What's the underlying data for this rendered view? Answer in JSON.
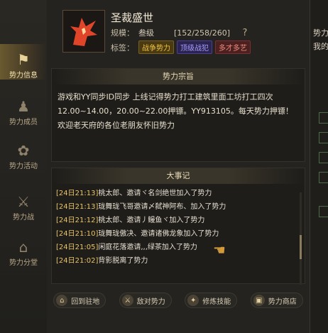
{
  "nav": {
    "items": [
      {
        "label": "势力信息",
        "icon": "banner-icon",
        "active": true
      },
      {
        "label": "势力成员",
        "icon": "people-icon",
        "active": false
      },
      {
        "label": "势力活动",
        "icon": "activity-icon",
        "active": false
      },
      {
        "label": "势力战",
        "icon": "battle-icon",
        "active": false
      },
      {
        "label": "势力分堂",
        "icon": "pavilion-icon",
        "active": false
      }
    ]
  },
  "guild": {
    "name": "圣裁盛世",
    "scale_label": "规模：",
    "scale_value": "叁级",
    "members": "[152/258/260]",
    "help": "?",
    "tags_label": "标签：",
    "tags": [
      "战争势力",
      "顶级战犯",
      "多才多艺"
    ]
  },
  "declaration": {
    "title": "势力宗旨",
    "text": "游戏和YY同步ID同步 上线记得势力打工建筑里面工坊打工四次12.00~14.00，20.00~22.00押镖。YY913105。每天势力押镖！欢迎老天府的各位老朋友怀旧势力"
  },
  "events": {
    "title": "大事记",
    "items": [
      {
        "time": "[24日21:13]",
        "text": "桃太郎、邀请ヾ名剑绝世加入了势力"
      },
      {
        "time": "[24日21:13]",
        "text": "珑舞珑飞哥邀请〆弑神阿布、加入了势力"
      },
      {
        "time": "[24日21:12]",
        "text": "桃太郎、邀请丿鳗鱼ヾ加入了势力"
      },
      {
        "time": "[24日21:10]",
        "text": "珑舞珑傲决、邀请诸佛龙象加入了势力"
      },
      {
        "time": "[24日21:05]",
        "text": "闲庭花落邀请,,,绿茶加入了势力"
      },
      {
        "time": "[24日21:02]",
        "text": "背影脱离了势力"
      }
    ]
  },
  "toolbar": {
    "buttons": [
      {
        "label": "回到驻地",
        "icon": "home-icon"
      },
      {
        "label": "敌对势力",
        "icon": "enemy-icon"
      },
      {
        "label": "修炼技能",
        "icon": "skill-icon"
      },
      {
        "label": "势力商店",
        "icon": "shop-icon"
      }
    ]
  },
  "right_strip": {
    "line1": "势力",
    "line2": "我的"
  },
  "colors": {
    "timestamp": "#e9c468",
    "accent_gold": "#f1c342",
    "panel_bg": "#1e1d1a"
  }
}
